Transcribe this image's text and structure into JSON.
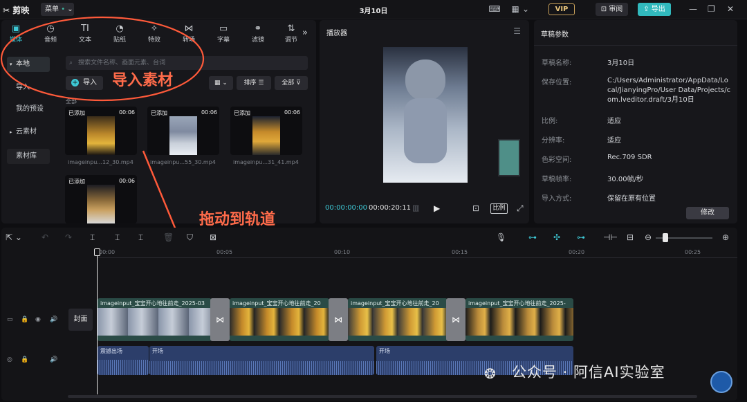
{
  "titlebar": {
    "app_name": "剪映",
    "menu_label": "菜单",
    "document_title": "3月10日",
    "vip_label": "VIP",
    "review_label": "审阅",
    "export_label": "导出"
  },
  "media_panel": {
    "tabs": [
      {
        "label": "媒体",
        "icon": "media-icon"
      },
      {
        "label": "音频",
        "icon": "audio-icon"
      },
      {
        "label": "文本",
        "icon": "text-icon"
      },
      {
        "label": "贴纸",
        "icon": "sticker-icon"
      },
      {
        "label": "特效",
        "icon": "effects-icon"
      },
      {
        "label": "转场",
        "icon": "transition-icon"
      },
      {
        "label": "字幕",
        "icon": "subtitle-icon"
      },
      {
        "label": "滤镜",
        "icon": "filter-icon"
      },
      {
        "label": "调节",
        "icon": "adjust-icon"
      }
    ],
    "sidebar": [
      {
        "label": "本地"
      },
      {
        "label": "导入"
      },
      {
        "label": "我的预设"
      },
      {
        "label": "云素材"
      },
      {
        "label": "素材库"
      }
    ],
    "search_placeholder": "搜索文件名称、画面元素、台词",
    "import_label": "导入",
    "sort_label": "排序",
    "filter_label": "全部",
    "section_label": "全部",
    "items": [
      {
        "status": "已添加",
        "duration": "00:06",
        "name": "imageinpu...12_30.mp4"
      },
      {
        "status": "已添加",
        "duration": "00:06",
        "name": "imageinpu...55_30.mp4"
      },
      {
        "status": "已添加",
        "duration": "00:06",
        "name": "imageinpu...31_41.mp4"
      },
      {
        "status": "已添加",
        "duration": "00:06",
        "name": ""
      }
    ]
  },
  "annotations": {
    "import_material": "导入素材",
    "drag_to_track": "拖动到轨道"
  },
  "player": {
    "title": "播放器",
    "current_time": "00:00:00:00",
    "total_time": "00:00:20:11",
    "ratio_label": "比例"
  },
  "draft": {
    "title": "草稿参数",
    "rows": [
      {
        "key": "草稿名称:",
        "value": "3月10日"
      },
      {
        "key": "保存位置:",
        "value": "C:/Users/Administrator/AppData/Local/JianyingPro/User Data/Projects/com.lveditor.draft/3月10日"
      },
      {
        "key": "比例:",
        "value": "适应"
      },
      {
        "key": "分辨率:",
        "value": "适应"
      },
      {
        "key": "色彩空间:",
        "value": "Rec.709 SDR"
      },
      {
        "key": "草稿帧率:",
        "value": "30.00帧/秒"
      },
      {
        "key": "导入方式:",
        "value": "保留在原有位置"
      }
    ],
    "modify_label": "修改"
  },
  "timeline": {
    "ruler": [
      "00:00",
      "00:05",
      "00:10",
      "00:15",
      "00:20",
      "00:25"
    ],
    "cover_label": "封面",
    "video_clips": [
      {
        "label": "imageinput_宝宝开心地往前走_2025-03"
      },
      {
        "label": "imageinput_宝宝开心地往前走_20"
      },
      {
        "label": "imageinput_宝宝开心地往前走_20"
      },
      {
        "label": "imageinput_宝宝开心地往前走_2025-"
      }
    ],
    "audio_clips": [
      {
        "label": "震撼出场"
      },
      {
        "label": "开场"
      },
      {
        "label": "开场"
      }
    ]
  },
  "watermark": "公众号 · 阿信AI实验室",
  "colors": {
    "accent": "#3ec9d6",
    "export": "#31b9bd",
    "annotation": "#ff6b4a",
    "video_track": "#2a4b46",
    "audio_track": "#2c3e6a"
  }
}
